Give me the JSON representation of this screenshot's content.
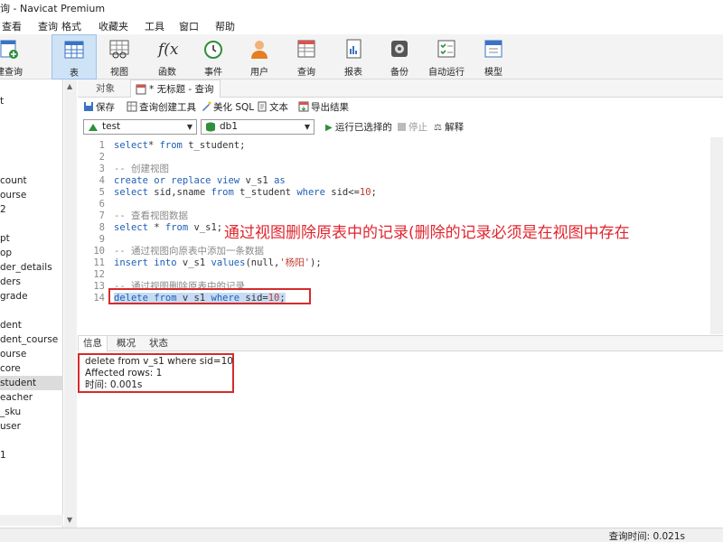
{
  "window": {
    "title": "询 - Navicat Premium"
  },
  "menu": [
    "查看",
    "查询",
    "格式",
    "收藏夹",
    "工具",
    "窗口",
    "帮助"
  ],
  "toolbar": {
    "items": [
      {
        "label": "建查询",
        "icon": "new-query-icon"
      },
      {
        "label": "表",
        "icon": "table-icon",
        "active": true
      },
      {
        "label": "视图",
        "icon": "view-icon"
      },
      {
        "label": "函数",
        "icon": "function-icon"
      },
      {
        "label": "事件",
        "icon": "event-clock-icon"
      },
      {
        "label": "用户",
        "icon": "user-icon"
      },
      {
        "label": "查询",
        "icon": "query-icon"
      },
      {
        "label": "报表",
        "icon": "report-icon"
      },
      {
        "label": "备份",
        "icon": "backup-icon"
      },
      {
        "label": "自动运行",
        "icon": "auto-run-icon"
      },
      {
        "label": "模型",
        "icon": "model-icon"
      }
    ]
  },
  "sidebar": {
    "items": [
      "t",
      "",
      "",
      "",
      "",
      "",
      "count",
      "ourse",
      "2",
      "",
      "",
      "pt",
      "op",
      "der_details",
      "ders",
      "grade",
      "",
      "dent",
      "dent_course",
      "ourse",
      "core",
      "student",
      "eacher",
      "_sku",
      "user",
      "",
      "1"
    ],
    "selected_index": 21
  },
  "tabs": {
    "objects": "对象",
    "query": "* 无标题 - 查询"
  },
  "query_toolbar": {
    "save": "保存",
    "builder": "查询创建工具",
    "beautify": "美化 SQL",
    "text": "文本",
    "export": "导出结果"
  },
  "connection": {
    "connection_value": "test",
    "database_value": "db1",
    "run_selected": "运行已选择的",
    "stop": "停止",
    "explain": "解释"
  },
  "editor": {
    "lines": [
      {
        "n": "1",
        "tokens": [
          [
            "kw",
            "select"
          ],
          [
            "",
            "* "
          ],
          [
            "kw",
            "from"
          ],
          [
            "",
            " t_student;"
          ]
        ]
      },
      {
        "n": "2",
        "tokens": []
      },
      {
        "n": "3",
        "tokens": [
          [
            "cm",
            "-- 创建视图"
          ]
        ]
      },
      {
        "n": "4",
        "tokens": [
          [
            "kw",
            "create"
          ],
          [
            "",
            " "
          ],
          [
            "kw",
            "or"
          ],
          [
            "",
            " "
          ],
          [
            "kw",
            "replace"
          ],
          [
            "",
            " "
          ],
          [
            "kw",
            "view"
          ],
          [
            "",
            " v_s1 "
          ],
          [
            "kw",
            "as"
          ]
        ]
      },
      {
        "n": "5",
        "tokens": [
          [
            "kw",
            "select"
          ],
          [
            "",
            " sid,sname "
          ],
          [
            "kw",
            "from"
          ],
          [
            "",
            " t_student "
          ],
          [
            "kw",
            "where"
          ],
          [
            "",
            " sid<="
          ],
          [
            "num",
            "10"
          ],
          [
            "",
            ";"
          ]
        ]
      },
      {
        "n": "6",
        "tokens": []
      },
      {
        "n": "7",
        "tokens": [
          [
            "cm",
            "-- 查看视图数据"
          ]
        ]
      },
      {
        "n": "8",
        "tokens": [
          [
            "kw",
            "select"
          ],
          [
            "",
            " * "
          ],
          [
            "kw",
            "from"
          ],
          [
            "",
            " v_s1;"
          ]
        ]
      },
      {
        "n": "9",
        "tokens": []
      },
      {
        "n": "10",
        "tokens": [
          [
            "cm",
            "-- 通过视图向原表中添加一条数据"
          ]
        ]
      },
      {
        "n": "11",
        "tokens": [
          [
            "kw",
            "insert"
          ],
          [
            "",
            " "
          ],
          [
            "kw",
            "into"
          ],
          [
            "",
            " v_s1 "
          ],
          [
            "kw",
            "values"
          ],
          [
            "",
            "(null,"
          ],
          [
            "str",
            "'杨阳'"
          ],
          [
            "",
            ");"
          ]
        ]
      },
      {
        "n": "12",
        "tokens": []
      },
      {
        "n": "13",
        "tokens": [
          [
            "cm",
            "-- 通过视图删除原表中的记录"
          ]
        ]
      },
      {
        "n": "14",
        "tokens": [
          [
            "kw",
            "delete"
          ],
          [
            "",
            " "
          ],
          [
            "kw",
            "from"
          ],
          [
            "",
            " v_s1 "
          ],
          [
            "kw",
            "where"
          ],
          [
            "",
            " sid="
          ],
          [
            "num",
            "10"
          ],
          [
            "",
            ";"
          ]
        ],
        "highlight": true
      }
    ]
  },
  "annotation": {
    "text": "通过视图删除原表中的记录(删除的记录必须是在视图中存在"
  },
  "result_tabs": [
    "信息",
    "概况",
    "状态"
  ],
  "result": {
    "line1": "delete from v_s1 where sid=10",
    "line2": "Affected rows: 1",
    "line3": "时间: 0.001s"
  },
  "status": {
    "query_time": "查询时间: 0.021s"
  },
  "colors": {
    "accent": "#cfe3f7",
    "annotation": "#e0252e",
    "keyword": "#1d5eb8"
  }
}
